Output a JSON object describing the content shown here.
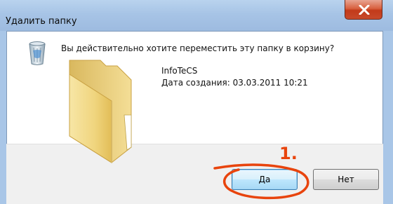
{
  "window": {
    "title": "Удалить папку",
    "close_icon": "close-icon"
  },
  "dialog": {
    "question": "Вы действительно хотите переместить эту папку в корзину?",
    "icon": "recycle-bin-icon",
    "item": {
      "icon": "folder-icon",
      "name": "InfoTeCS",
      "created": "Дата создания: 03.03.2011 10:21"
    }
  },
  "buttons": {
    "yes_label": "Да",
    "no_label": "Нет"
  },
  "annotation": {
    "number": "1.",
    "color": "#e8440d"
  },
  "colors": {
    "titlebar": "#a7c4e6",
    "close": "#c7492a",
    "body": "#ffffff",
    "button_band": "#f0f0f0"
  }
}
